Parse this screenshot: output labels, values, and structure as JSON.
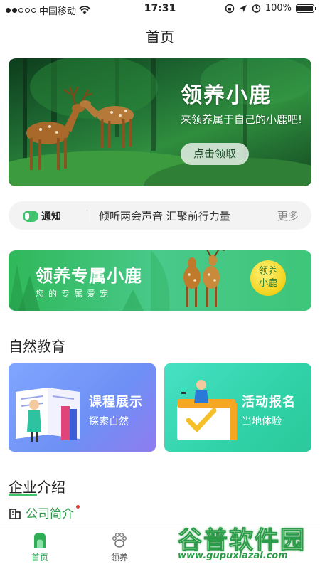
{
  "status_bar": {
    "carrier": "中国移动",
    "time": "17:31",
    "battery": "100%"
  },
  "nav": {
    "title": "首页"
  },
  "banner": {
    "title": "领养小鹿",
    "subtitle": "来领养属于自己的小鹿吧!",
    "button": "点击领取"
  },
  "notice": {
    "tag": "通知",
    "text": "倾听两会声音 汇聚前行力量",
    "more": "更多"
  },
  "promo": {
    "title": "领养专属小鹿",
    "subtitle": "您的专属爱宠",
    "badge_line1": "领养",
    "badge_line2": "小鹿"
  },
  "nature_section": {
    "title": "自然教育",
    "cards": [
      {
        "title": "课程展示",
        "subtitle": "探索自然"
      },
      {
        "title": "活动报名",
        "subtitle": "当地体验"
      }
    ]
  },
  "company_section": {
    "title": "企业介绍",
    "item": "公司简介"
  },
  "tab_bar": {
    "tabs": [
      {
        "label": "首页",
        "icon": "home-icon",
        "active": true
      },
      {
        "label": "领养",
        "icon": "paw-icon",
        "active": false
      }
    ]
  },
  "watermark": {
    "text": "谷普软件园",
    "url": "www.gupuxlazal.com"
  },
  "colors": {
    "accent": "#2fae56",
    "promo_green": "#3ec67a",
    "card_blue": "#7fa6ff",
    "card_teal": "#31d2a8"
  }
}
